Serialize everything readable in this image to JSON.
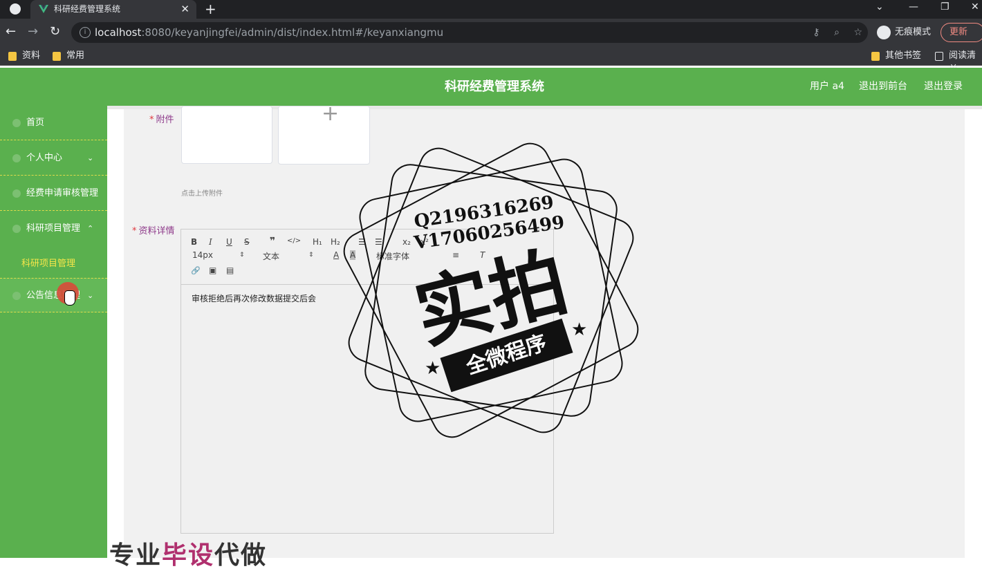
{
  "browser": {
    "tab_title": "科研经费管理系统",
    "tab_close": "✕",
    "new_tab": "+",
    "url_host": "localhost",
    "url_path": ":8080/keyanjingfei/admin/dist/index.html#/keyanxiangmu",
    "incognito_label": "无痕模式",
    "update_label": "更新",
    "bookmarks": [
      "资料",
      "常用"
    ],
    "bookmarks_right": [
      "其他书签",
      "阅读清单"
    ]
  },
  "header": {
    "title": "科研经费管理系统",
    "user": "用户 a4",
    "back_front": "退出到前台",
    "logout": "退出登录"
  },
  "sidebar": {
    "items": [
      {
        "label": "首页"
      },
      {
        "label": "个人中心"
      },
      {
        "label": "经费申请审核管理"
      },
      {
        "label": "科研项目管理"
      },
      {
        "label": "公告信息管理"
      }
    ],
    "submenu_item": "科研项目管理"
  },
  "form": {
    "attachment_label": "附件",
    "required_mark": "*",
    "upload_hint": "点击上传附件",
    "details_label": "资料详情",
    "toolbar": {
      "bold": "B",
      "italic": "I",
      "underline": "U",
      "strike": "S",
      "quote": "❞",
      "code": "</>",
      "h1": "H₁",
      "h2": "H₂",
      "ol": "☰",
      "ul": "☰",
      "sub": "x₂",
      "sup": "x²",
      "font_size": "14px",
      "text_type": "文本",
      "font_family": "标准字体",
      "link": "🔗",
      "image": "▣",
      "video": "▤"
    },
    "editor_content": "审核拒绝后再次修改数据提交后会"
  },
  "watermark": {
    "qq": "Q2196316269",
    "vx": "V17060256499",
    "big": "实拍",
    "banner": "全微程序",
    "bottom": "专业",
    "bottom_pink": "毕设",
    "bottom_end": "代做"
  }
}
